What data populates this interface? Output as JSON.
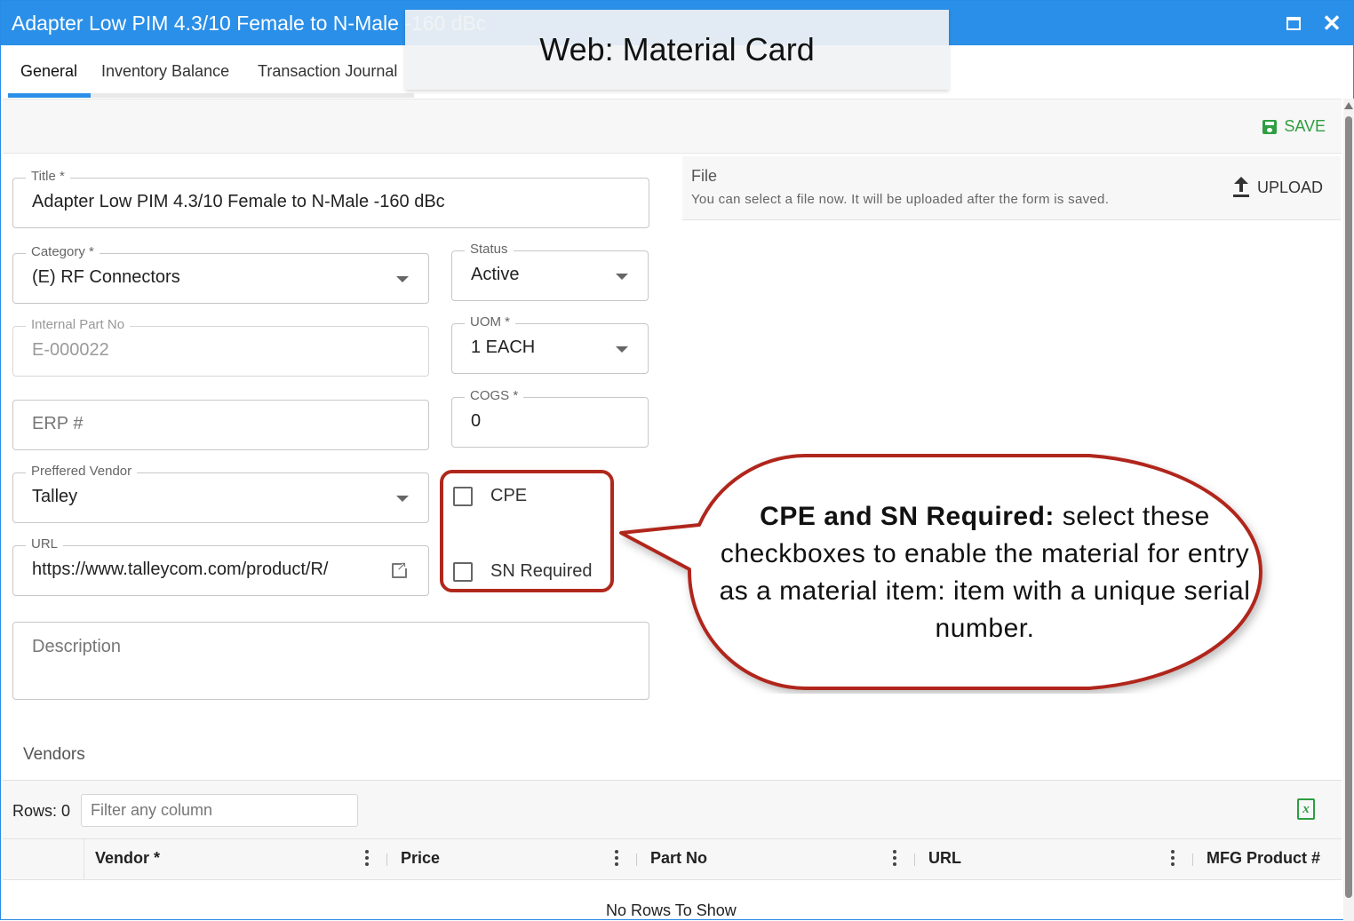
{
  "window": {
    "title": "Adapter Low PIM 4.3/10 Female to N-Male -160 dBc",
    "overlay_label": "Web: Material Card"
  },
  "tabs": [
    {
      "label": "General",
      "active": true
    },
    {
      "label": "Inventory Balance",
      "active": false
    },
    {
      "label": "Transaction Journal",
      "active": false
    }
  ],
  "toolbar": {
    "save_label": "SAVE"
  },
  "form": {
    "title": {
      "label": "Title *",
      "value": "Adapter Low PIM 4.3/10 Female to N-Male -160 dBc"
    },
    "category": {
      "label": "Category *",
      "value": "(E) RF Connectors"
    },
    "status": {
      "label": "Status",
      "value": "Active"
    },
    "internal_part_no": {
      "label": "Internal Part No",
      "value": "E-000022"
    },
    "uom": {
      "label": "UOM *",
      "value": "1 EACH"
    },
    "erp": {
      "placeholder": "ERP #"
    },
    "cogs": {
      "label": "COGS *",
      "value": "0"
    },
    "vendor": {
      "label": "Preffered Vendor",
      "value": "Talley"
    },
    "cpe": {
      "label": "CPE",
      "checked": false
    },
    "sn_required": {
      "label": "SN Required",
      "checked": false
    },
    "url": {
      "label": "URL",
      "value": "https://www.talleycom.com/product/R/"
    },
    "description": {
      "placeholder": "Description"
    }
  },
  "file": {
    "title": "File",
    "hint": "You can select a file now. It will be uploaded after the form is saved.",
    "upload_label": "UPLOAD"
  },
  "callout": {
    "bold": "CPE and SN Required:",
    "text": " select these checkboxes to enable the material for entry as a material item: item with a unique serial number.",
    "border_color": "#b0281c"
  },
  "vendors": {
    "section_title": "Vendors",
    "rows_label": "Rows: 0",
    "filter_placeholder": "Filter any column",
    "columns": [
      "Vendor *",
      "Price",
      "Part No",
      "URL",
      "MFG Product #"
    ],
    "empty_message": "No Rows To Show"
  },
  "colors": {
    "titlebar": "#2a8fe8",
    "save_green": "#2f9e41",
    "callout_red": "#b0281c"
  }
}
